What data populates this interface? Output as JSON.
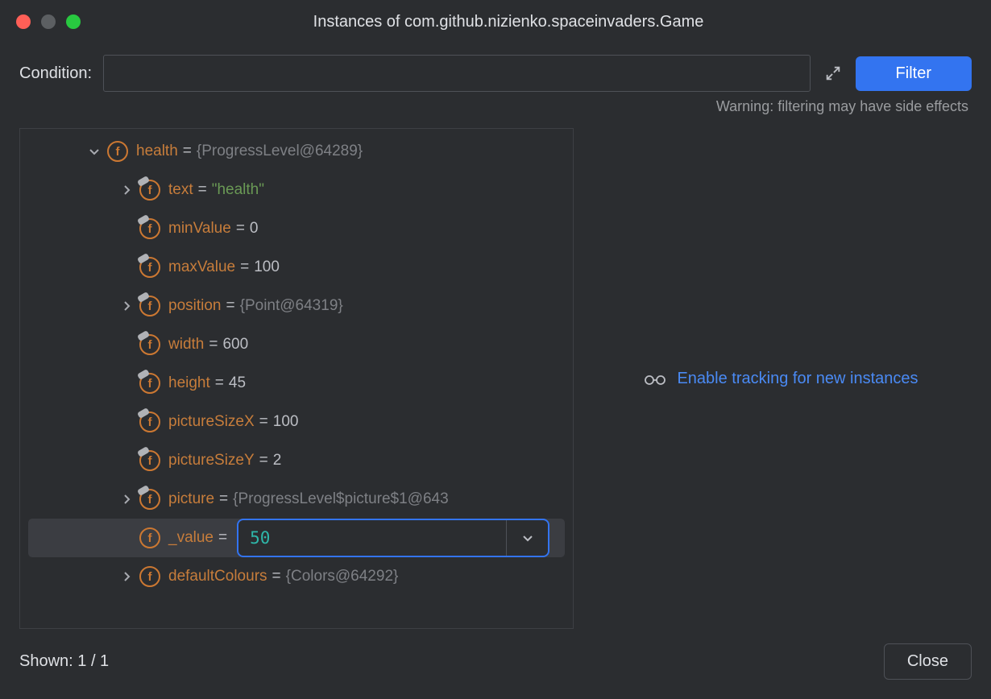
{
  "title": "Instances of com.github.nizienko.spaceinvaders.Game",
  "condition": {
    "label": "Condition:",
    "value": "",
    "placeholder": ""
  },
  "filter_button": "Filter",
  "warning": "Warning: filtering may have side effects",
  "tracking_link": "Enable tracking for new instances",
  "shown": "Shown: 1 / 1",
  "close_button": "Close",
  "value_editor": {
    "value": "50"
  },
  "tree": {
    "root": {
      "name": "health",
      "value": "{ProgressLevel@64289}"
    },
    "children": [
      {
        "name": "text",
        "value": "\"health\"",
        "type": "string",
        "expandable": true
      },
      {
        "name": "minValue",
        "value": "0",
        "type": "number",
        "expandable": false
      },
      {
        "name": "maxValue",
        "value": "100",
        "type": "number",
        "expandable": false
      },
      {
        "name": "position",
        "value": "{Point@64319}",
        "type": "object",
        "expandable": true
      },
      {
        "name": "width",
        "value": "600",
        "type": "number",
        "expandable": false
      },
      {
        "name": "height",
        "value": "45",
        "type": "number",
        "expandable": false
      },
      {
        "name": "pictureSizeX",
        "value": "100",
        "type": "number",
        "expandable": false
      },
      {
        "name": "pictureSizeY",
        "value": "2",
        "type": "number",
        "expandable": false
      },
      {
        "name": "picture",
        "value": "{ProgressLevel$picture$1@643",
        "type": "object",
        "expandable": true
      },
      {
        "name": "_value",
        "value": "50",
        "type": "editor",
        "expandable": false
      },
      {
        "name": "defaultColours",
        "value": "{Colors@64292}",
        "type": "object",
        "expandable": true
      }
    ]
  }
}
